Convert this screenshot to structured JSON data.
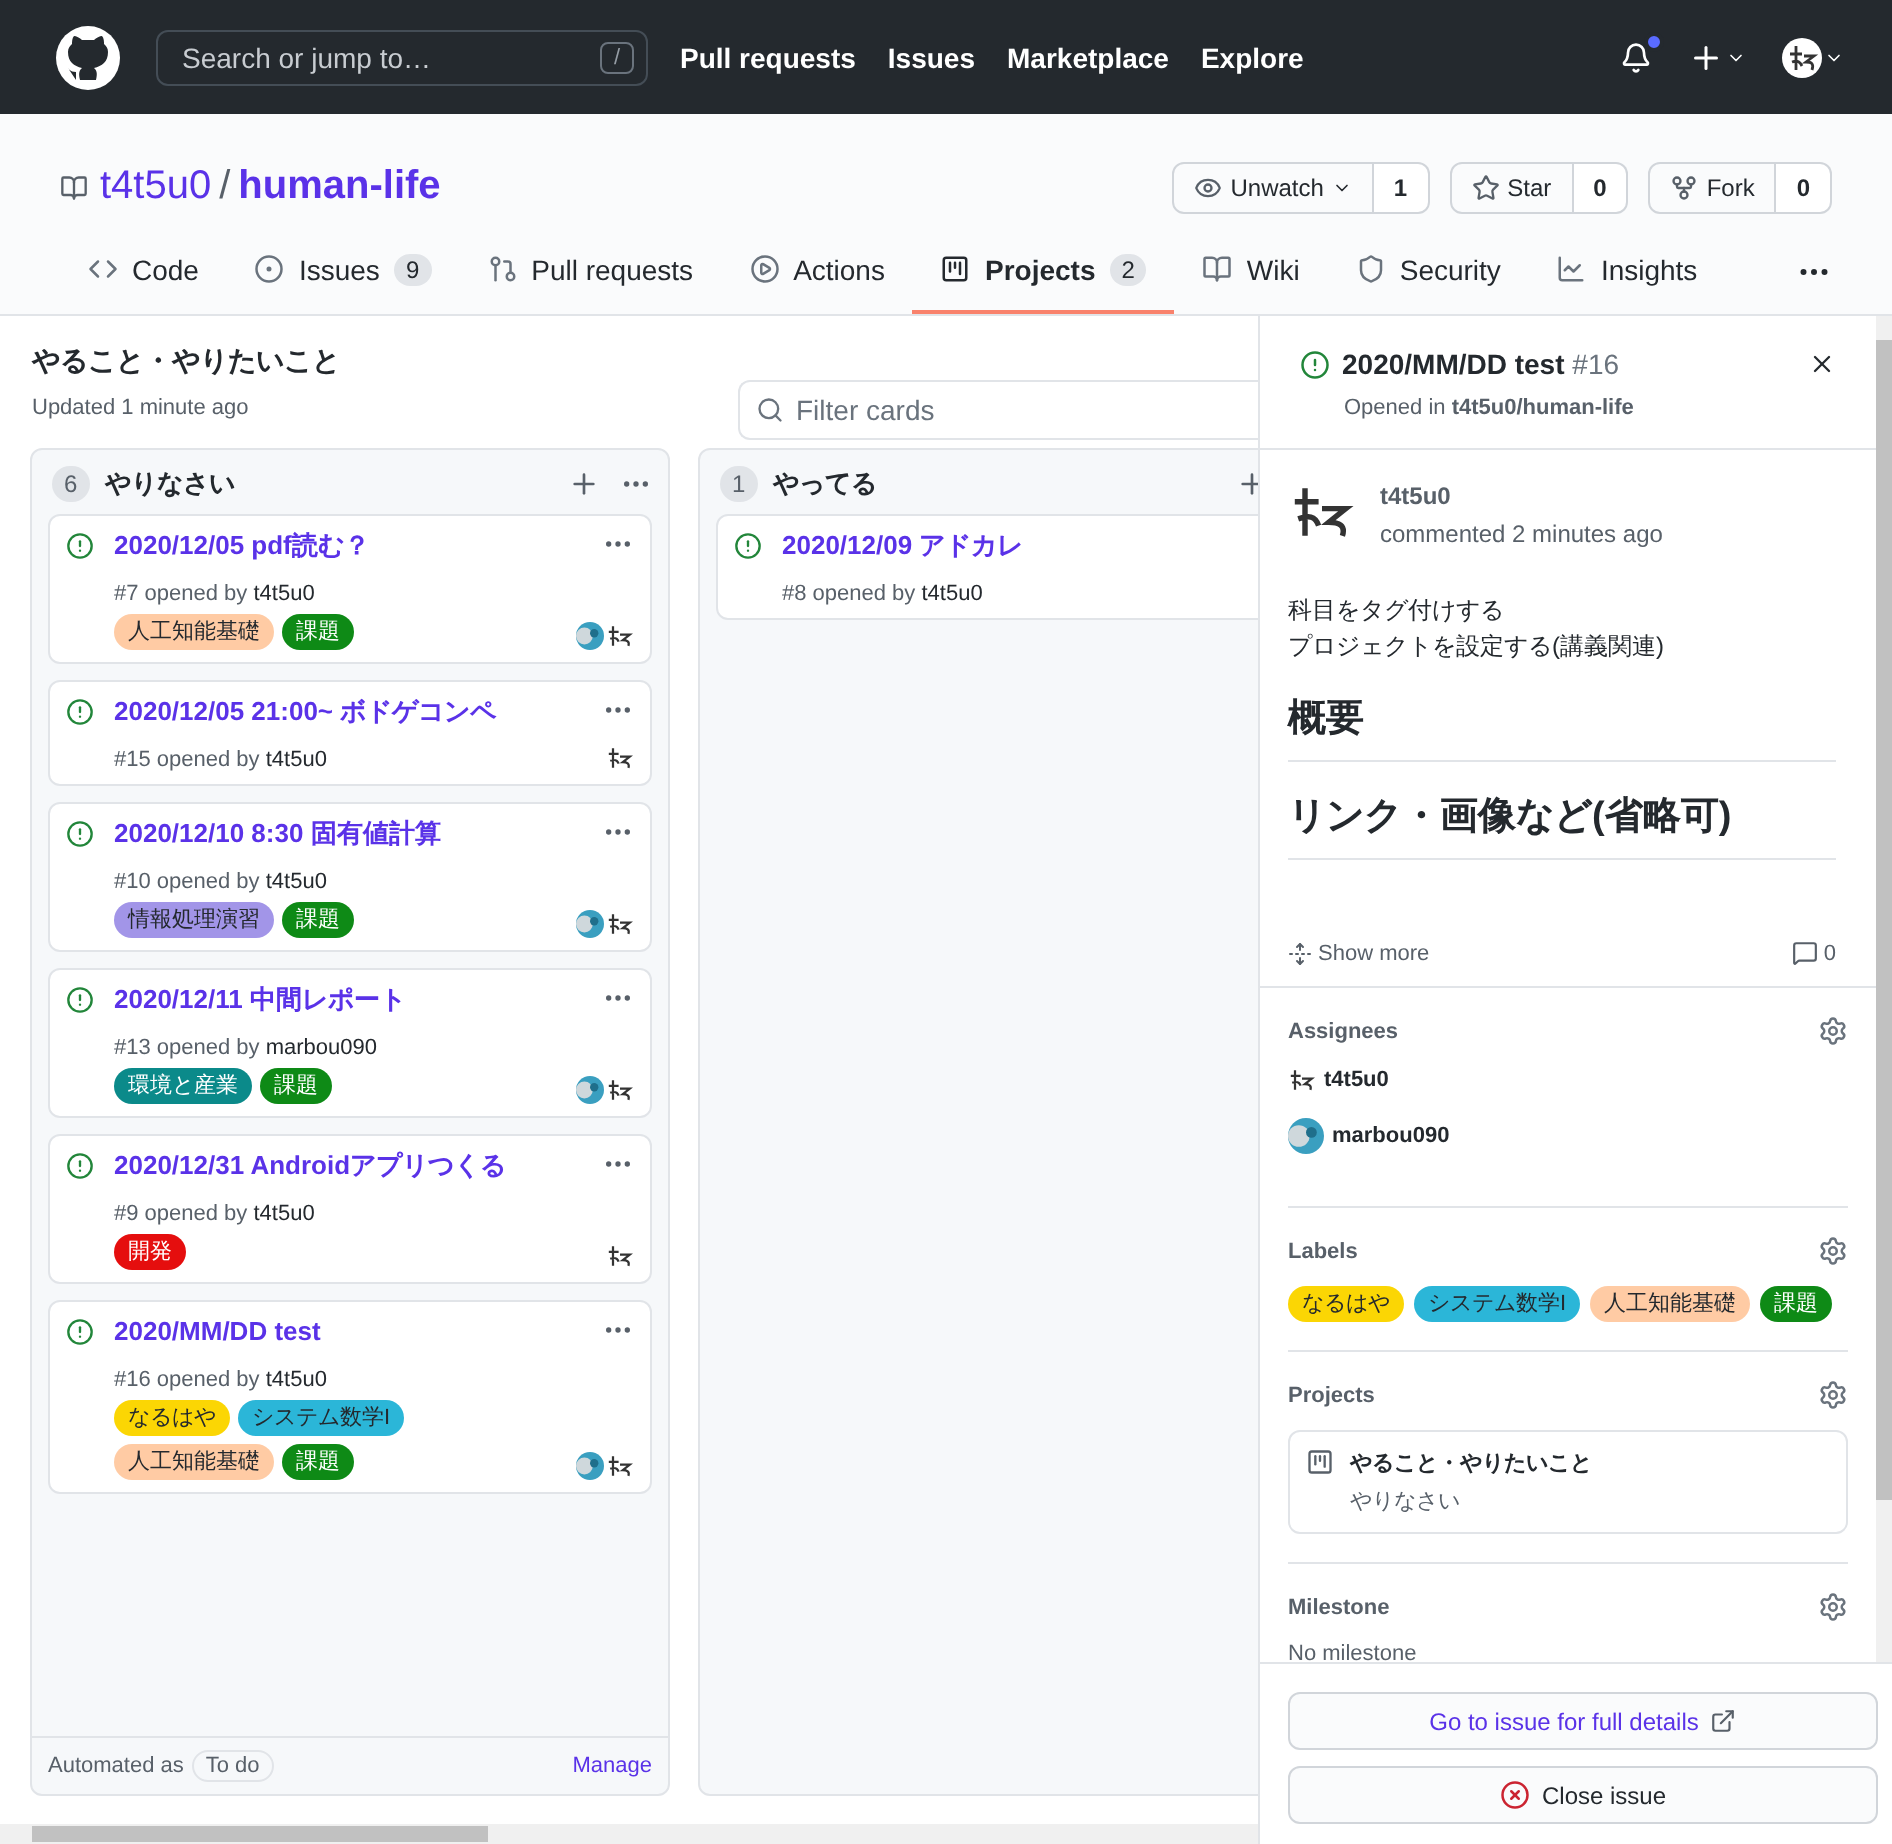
{
  "top_nav": {
    "search_placeholder": "Search or jump to…",
    "search_key": "/",
    "links": [
      "Pull requests",
      "Issues",
      "Marketplace",
      "Explore"
    ],
    "notification_unread": true
  },
  "repo": {
    "owner": "t4t5u0",
    "separator": "/",
    "name": "human-life",
    "actions": [
      {
        "kind": "watch",
        "label": "Unwatch",
        "count": "1"
      },
      {
        "kind": "star",
        "label": "Star",
        "count": "0"
      },
      {
        "kind": "fork",
        "label": "Fork",
        "count": "0"
      }
    ]
  },
  "tabs": [
    {
      "kind": "code",
      "label": "Code",
      "selected": false
    },
    {
      "kind": "issues",
      "label": "Issues",
      "counter": "9",
      "selected": false
    },
    {
      "kind": "pulls",
      "label": "Pull requests",
      "selected": false
    },
    {
      "kind": "actions",
      "label": "Actions",
      "selected": false
    },
    {
      "kind": "projects",
      "label": "Projects",
      "counter": "2",
      "selected": true
    },
    {
      "kind": "wiki",
      "label": "Wiki",
      "selected": false
    },
    {
      "kind": "security",
      "label": "Security",
      "selected": false
    },
    {
      "kind": "insights",
      "label": "Insights",
      "selected": false
    }
  ],
  "project": {
    "title": "やること・やりたいこと",
    "updated": "Updated 1 minute ago",
    "filter_placeholder": "Filter cards"
  },
  "columns": [
    {
      "count": "6",
      "name": "やりなさい",
      "menus_visible": true,
      "cards": [
        {
          "title": "2020/12/05 pdf読む？",
          "meta": "#7 opened by",
          "author": "t4t5u0",
          "labels": [
            {
              "text": "人工知能基礎",
              "color": "#ffcba4"
            },
            {
              "text": "課題",
              "color": "#0e8a16"
            }
          ],
          "assignees": [
            {
              "kind": "photo"
            },
            {
              "kind": "sketch"
            }
          ]
        },
        {
          "title": "2020/12/05 21:00~ ボドゲコンペ",
          "meta": "#15 opened by",
          "author": "t4t5u0",
          "assignees": [
            {
              "kind": "sketch"
            }
          ]
        },
        {
          "title": "2020/12/10 8:30 固有値計算",
          "meta": "#10 opened by",
          "author": "t4t5u0",
          "labels": [
            {
              "text": "情報処理演習",
              "color": "#a295e8"
            },
            {
              "text": "課題",
              "color": "#0e8a16"
            }
          ],
          "assignees": [
            {
              "kind": "photo"
            },
            {
              "kind": "sketch"
            }
          ]
        },
        {
          "title": "2020/12/11 中間レポート",
          "meta": "#13 opened by",
          "author": "marbou090",
          "labels": [
            {
              "text": "環境と産業",
              "color": "#0b8a8a"
            },
            {
              "text": "課題",
              "color": "#0e8a16"
            }
          ],
          "assignees": [
            {
              "kind": "photo"
            },
            {
              "kind": "sketch"
            }
          ]
        },
        {
          "title": "2020/12/31 Androidアプリつくる",
          "meta": "#9 opened by",
          "author": "t4t5u0",
          "labels": [
            {
              "text": "開発",
              "color": "#e50e0e"
            }
          ],
          "assignees": [
            {
              "kind": "sketch"
            }
          ]
        },
        {
          "title": "2020/MM/DD test",
          "meta": "#16 opened by",
          "author": "t4t5u0",
          "labels": [
            {
              "text": "なるはや",
              "color": "#fbd604"
            },
            {
              "text": "システム数学I",
              "color": "#2bb6d8"
            },
            {
              "text": "人工知能基礎",
              "color": "#ffcba4"
            },
            {
              "text": "課題",
              "color": "#0e8a16"
            }
          ],
          "assignees": [
            {
              "kind": "photo"
            },
            {
              "kind": "sketch"
            }
          ]
        }
      ],
      "footer": {
        "prefix": "Automated as",
        "preset": "To do",
        "link": "Manage"
      }
    },
    {
      "count": "1",
      "name": "やってる",
      "cards": [
        {
          "title": "2020/12/09 アドカレ",
          "meta": "#8 opened by",
          "author": "t4t5u0"
        }
      ]
    }
  ],
  "issue_panel": {
    "title": "2020/MM/DD test",
    "number": "#16",
    "opened_prefix": "Opened in",
    "repo": "t4t5u0/human-life",
    "comment": {
      "author": "t4t5u0",
      "time": "commented 2 minutes ago",
      "lines": [
        "科目をタグ付けする",
        "プロジェクトを設定する(講義関連)"
      ],
      "headings": [
        "概要",
        "リンク・画像など(省略可)"
      ],
      "show_more": "Show more",
      "comment_count": "0"
    },
    "assignees": {
      "heading": "Assignees",
      "people": [
        {
          "name": "t4t5u0",
          "kind": "sketch"
        },
        {
          "name": "marbou090",
          "kind": "photo"
        }
      ]
    },
    "labels": {
      "heading": "Labels",
      "items": [
        {
          "text": "なるはや",
          "color": "#fbd604"
        },
        {
          "text": "システム数学I",
          "color": "#2bb6d8"
        },
        {
          "text": "人工知能基礎",
          "color": "#ffcba4"
        },
        {
          "text": "課題",
          "color": "#0e8a16"
        }
      ]
    },
    "projects": {
      "heading": "Projects",
      "name": "やること・やりたいこと",
      "column": "やりなさい"
    },
    "milestone": {
      "heading": "Milestone",
      "value": "No milestone"
    },
    "buttons": [
      {
        "kind": "open",
        "label": "Go to issue for full details"
      },
      {
        "kind": "close",
        "label": "Close issue"
      }
    ]
  }
}
